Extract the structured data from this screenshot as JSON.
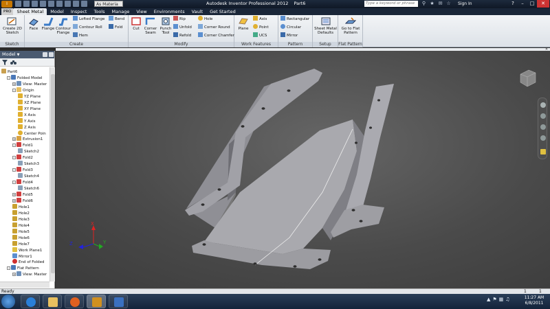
{
  "titlebar": {
    "material_select": "As Materia",
    "app_title": "Autodesk Inventor Professional 2012",
    "document": "Part6",
    "search_placeholder": "Type a keyword or phrase",
    "sign_in": "Sign In"
  },
  "ribbon_tabs": [
    "Sheet Metal",
    "Model",
    "Inspect",
    "Tools",
    "Manage",
    "View",
    "Environments",
    "Vault",
    "Get Started"
  ],
  "ribbon_pro_tab": "PRO",
  "ribbon": {
    "sketch": {
      "create_2d_sketch": "Create 2D Sketch",
      "label": "Sketch"
    },
    "create": {
      "face": "Face",
      "flange": "Flange",
      "contour_flange": "Contour Flange",
      "lofted_flange": "Lofted Flange",
      "contour_roll": "Contour Roll",
      "hem": "Hem",
      "bend": "Bend",
      "fold": "Fold",
      "label": "Create"
    },
    "modify": {
      "cut": "Cut",
      "corner_seam": "Corner Seam",
      "punch_tool": "Punch Tool",
      "rip": "Rip",
      "unfold": "Unfold",
      "refold": "Refold",
      "hole": "Hole",
      "corner_round": "Corner Round",
      "corner_chamfer": "Corner Chamfer",
      "label": "Modify"
    },
    "work_features": {
      "plane": "Plane",
      "axis": "Axis",
      "point": "Point",
      "ucs": "UCS",
      "label": "Work Features"
    },
    "pattern": {
      "rectangular": "Rectangular",
      "circular": "Circular",
      "mirror": "Mirror",
      "label": "Pattern"
    },
    "setup": {
      "sheet_metal_defaults": "Sheet Metal Defaults",
      "label": "Setup"
    },
    "flat_pattern": {
      "go_to_flat_pattern": "Go to Flat Pattern",
      "label": "Flat Pattern"
    }
  },
  "browser": {
    "title": "Model",
    "items": [
      {
        "label": "Part6",
        "icon": "part-icon"
      },
      {
        "label": "Folded Model",
        "icon": "folded-model-icon"
      },
      {
        "label": "View: Master",
        "icon": "view-icon"
      },
      {
        "label": "Origin",
        "icon": "folder-icon"
      },
      {
        "label": "YZ Plane",
        "icon": "plane-icon"
      },
      {
        "label": "XZ Plane",
        "icon": "plane-icon"
      },
      {
        "label": "XY Plane",
        "icon": "plane-icon"
      },
      {
        "label": "X Axis",
        "icon": "axis-icon"
      },
      {
        "label": "Y Axis",
        "icon": "axis-icon"
      },
      {
        "label": "Z Axis",
        "icon": "axis-icon"
      },
      {
        "label": "Center Poin",
        "icon": "point-icon"
      },
      {
        "label": "Extrusion1",
        "icon": "extrusion-icon"
      },
      {
        "label": "Fold1",
        "icon": "fold-icon"
      },
      {
        "label": "Sketch2",
        "icon": "sketch-icon"
      },
      {
        "label": "Fold2",
        "icon": "fold-icon"
      },
      {
        "label": "Sketch3",
        "icon": "sketch-icon"
      },
      {
        "label": "Fold3",
        "icon": "fold-icon"
      },
      {
        "label": "Sketch4",
        "icon": "sketch-icon"
      },
      {
        "label": "Fold4",
        "icon": "fold-icon"
      },
      {
        "label": "Sketch6",
        "icon": "sketch-icon"
      },
      {
        "label": "Fold5",
        "icon": "fold-icon"
      },
      {
        "label": "Fold6",
        "icon": "fold-icon"
      },
      {
        "label": "Hole1",
        "icon": "hole-icon"
      },
      {
        "label": "Hole2",
        "icon": "hole-icon"
      },
      {
        "label": "Hole3",
        "icon": "hole-icon"
      },
      {
        "label": "Hole4",
        "icon": "hole-icon"
      },
      {
        "label": "Hole5",
        "icon": "hole-icon"
      },
      {
        "label": "Hole6",
        "icon": "hole-icon"
      },
      {
        "label": "Hole7",
        "icon": "hole-icon"
      },
      {
        "label": "Work Plane1",
        "icon": "work-plane-icon"
      },
      {
        "label": "Mirror1",
        "icon": "mirror-icon"
      },
      {
        "label": "End of Folded",
        "icon": "end-of-part-icon"
      },
      {
        "label": "Flat Pattern",
        "icon": "flat-pattern-icon"
      },
      {
        "label": "View: Master",
        "icon": "view-icon"
      }
    ]
  },
  "triad": {
    "x": "X",
    "y": "Y",
    "z": "Z"
  },
  "status": {
    "text": "Ready",
    "count1": "1",
    "count2": "1"
  },
  "clock": {
    "time": "11:27 AM",
    "date": "6/8/2011"
  },
  "colors": {
    "part": "#9a9aa0",
    "viewport_bg": "#4a4a4a",
    "axis_x": "#d22",
    "axis_y": "#2a2",
    "axis_z": "#22d"
  }
}
